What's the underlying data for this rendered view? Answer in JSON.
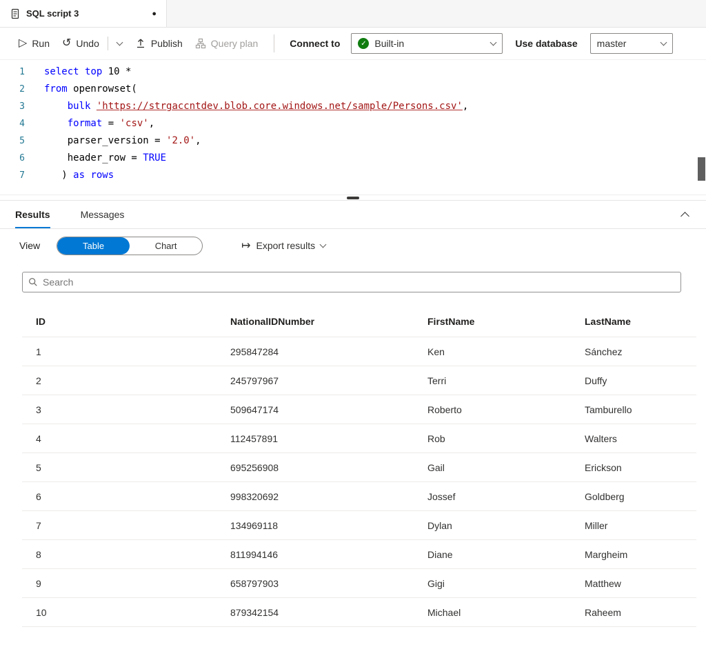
{
  "tab": {
    "title": "SQL script 3"
  },
  "icons": {
    "run": "▷",
    "undo": "↺",
    "modified_dot": "●",
    "check": "✓",
    "export": "↦"
  },
  "toolbar": {
    "run_label": "Run",
    "undo_label": "Undo",
    "publish_label": "Publish",
    "query_plan_label": "Query plan",
    "connect_to_label": "Connect to",
    "connection_value": "Built-in",
    "use_database_label": "Use database",
    "database_value": "master"
  },
  "editor": {
    "lines": [
      {
        "num": "1",
        "tokens": [
          {
            "t": "select",
            "c": "kw"
          },
          {
            "t": " ",
            "c": "pl"
          },
          {
            "t": "top",
            "c": "kw"
          },
          {
            "t": " 10 *",
            "c": "pl"
          }
        ]
      },
      {
        "num": "2",
        "tokens": [
          {
            "t": "from",
            "c": "kw"
          },
          {
            "t": " openrowset(",
            "c": "pl"
          }
        ]
      },
      {
        "num": "3",
        "tokens": [
          {
            "t": "    ",
            "c": "pl"
          },
          {
            "t": "bulk",
            "c": "kw"
          },
          {
            "t": " ",
            "c": "pl"
          },
          {
            "t": "'https://strgaccntdev.blob.core.windows.net/sample/Persons.csv'",
            "c": "stru"
          },
          {
            "t": ",",
            "c": "pl"
          }
        ]
      },
      {
        "num": "4",
        "tokens": [
          {
            "t": "    ",
            "c": "pl"
          },
          {
            "t": "format",
            "c": "kw"
          },
          {
            "t": " = ",
            "c": "pl"
          },
          {
            "t": "'csv'",
            "c": "str"
          },
          {
            "t": ",",
            "c": "pl"
          }
        ]
      },
      {
        "num": "5",
        "tokens": [
          {
            "t": "    parser_version = ",
            "c": "pl"
          },
          {
            "t": "'2.0'",
            "c": "str"
          },
          {
            "t": ",",
            "c": "pl"
          }
        ]
      },
      {
        "num": "6",
        "tokens": [
          {
            "t": "    header_row = ",
            "c": "pl"
          },
          {
            "t": "TRUE",
            "c": "kw"
          }
        ]
      },
      {
        "num": "7",
        "tokens": [
          {
            "t": "   ) ",
            "c": "pl"
          },
          {
            "t": "as",
            "c": "kw"
          },
          {
            "t": " ",
            "c": "pl"
          },
          {
            "t": "rows",
            "c": "kw"
          }
        ]
      }
    ]
  },
  "results_pane": {
    "tabs": [
      {
        "label": "Results"
      },
      {
        "label": "Messages"
      }
    ],
    "view_label": "View",
    "toggle": {
      "options": [
        "Table",
        "Chart"
      ],
      "selected": "Table"
    },
    "export_label": "Export results",
    "search_placeholder": "Search"
  },
  "results_table": {
    "columns": [
      "ID",
      "NationalIDNumber",
      "FirstName",
      "LastName"
    ],
    "rows": [
      [
        "1",
        "295847284",
        "Ken",
        "Sánchez"
      ],
      [
        "2",
        "245797967",
        "Terri",
        "Duffy"
      ],
      [
        "3",
        "509647174",
        "Roberto",
        "Tamburello"
      ],
      [
        "4",
        "112457891",
        "Rob",
        "Walters"
      ],
      [
        "5",
        "695256908",
        "Gail",
        "Erickson"
      ],
      [
        "6",
        "998320692",
        "Jossef",
        "Goldberg"
      ],
      [
        "7",
        "134969118",
        "Dylan",
        "Miller"
      ],
      [
        "8",
        "811994146",
        "Diane",
        "Margheim"
      ],
      [
        "9",
        "658797903",
        "Gigi",
        "Matthew"
      ],
      [
        "10",
        "879342154",
        "Michael",
        "Raheem"
      ]
    ]
  },
  "colors": {
    "accent": "#0078d4",
    "keyword": "#0000ff",
    "string": "#a31515",
    "check_green": "#107c10"
  }
}
